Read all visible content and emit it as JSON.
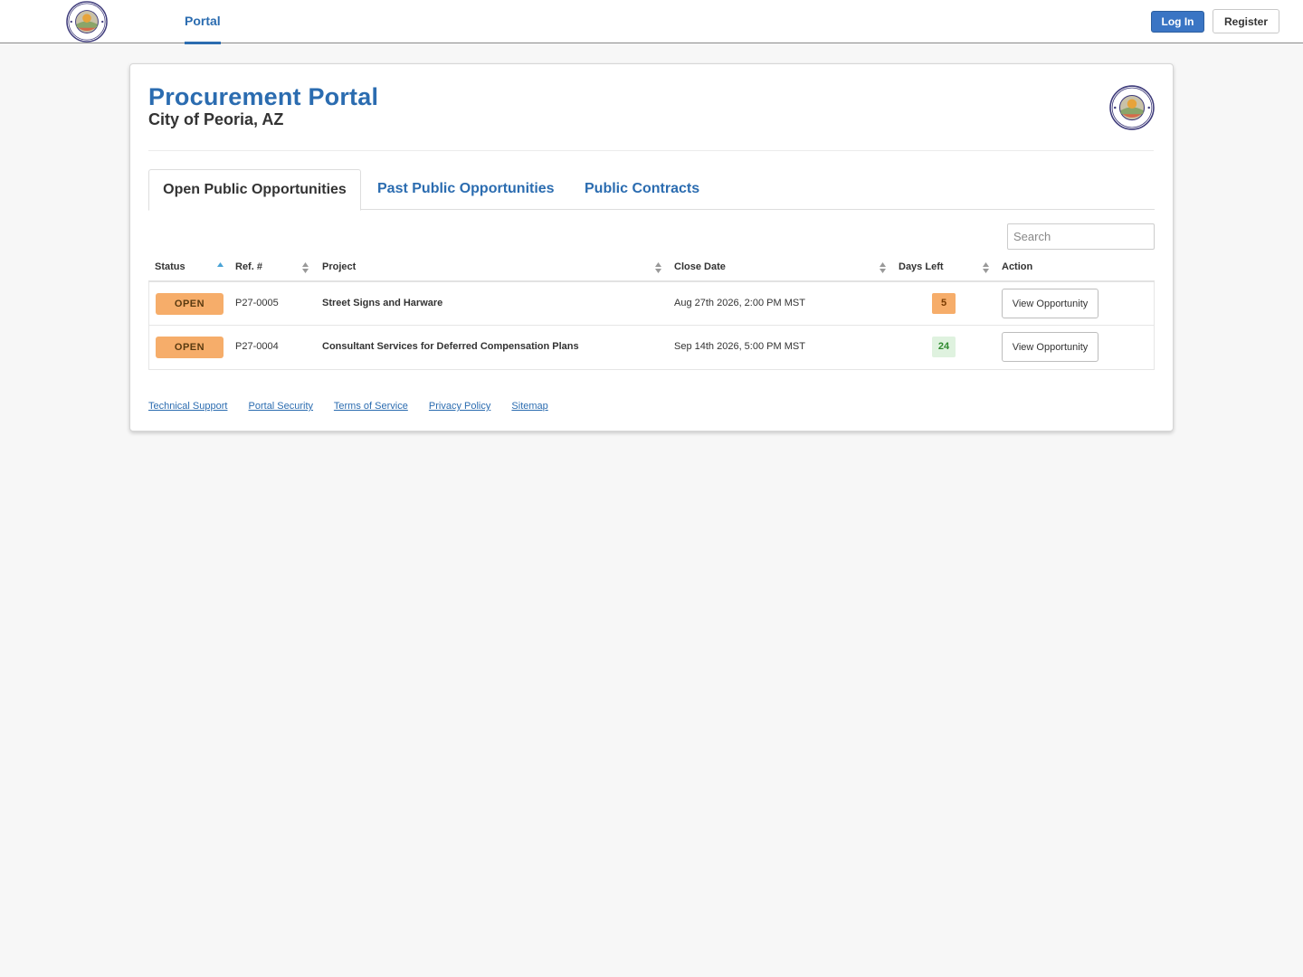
{
  "nav": {
    "logo_icon": "peoria-arizona-seal-icon",
    "portal_label": "Portal",
    "login_label": "Log In",
    "register_label": "Register"
  },
  "header": {
    "title": "Procurement Portal",
    "subtitle": "City of Peoria, AZ"
  },
  "tabs": [
    {
      "label": "Open Public Opportunities",
      "active": true
    },
    {
      "label": "Past Public Opportunities",
      "active": false
    },
    {
      "label": "Public Contracts",
      "active": false
    }
  ],
  "search": {
    "placeholder": "Search",
    "value": ""
  },
  "table": {
    "columns": [
      "Status",
      "Ref. #",
      "Project",
      "Close Date",
      "Days Left",
      "Action"
    ],
    "rows": [
      {
        "status": "OPEN",
        "ref": "P27-0005",
        "project": "Street Signs and Harware",
        "close_date": "Aug 27th 2026, 2:00 PM MST",
        "days_left": "5",
        "action": "View Opportunity"
      },
      {
        "status": "OPEN",
        "ref": "P27-0004",
        "project": "Consultant Services for Deferred Compensation Plans",
        "close_date": "Sep 14th 2026, 5:00 PM MST",
        "days_left": "24",
        "action": "View Opportunity"
      }
    ]
  },
  "footer": {
    "links": [
      "Technical Support",
      "Portal Security",
      "Terms of Service",
      "Privacy Policy",
      "Sitemap"
    ]
  },
  "colors": {
    "brand_blue": "#2b6cb0",
    "open_badge": "#f6ad6a",
    "days_urgent": "#f6ad6a",
    "days_ok": "#dff2df"
  }
}
